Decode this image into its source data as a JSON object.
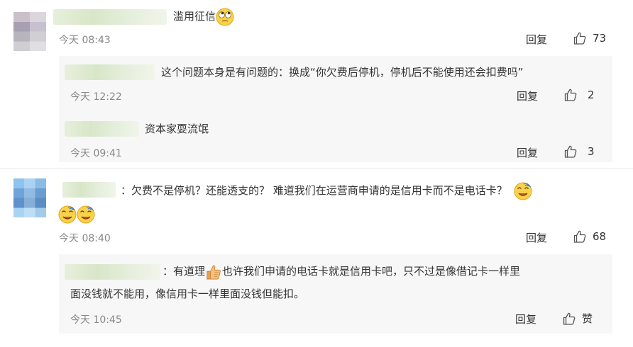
{
  "comments": [
    {
      "text": "滥用征信",
      "time": "今天 08:43",
      "reply_label": "回复",
      "likes": "73",
      "icon": "eye-roll-emoji",
      "replies": [
        {
          "text": "这个问题本身是有问题的：换成“你欠费后停机，停机后不能使用还会扣费吗”",
          "time": "今天 12:22",
          "reply_label": "回复",
          "likes": "2"
        },
        {
          "text": "资本家耍流氓",
          "time": "今天 09:41",
          "reply_label": "回复",
          "likes": "3"
        }
      ]
    },
    {
      "text_line1": "：欠费不是停机？还能透支的？ 难道我们在运营商申请的是信用卡而不是电话卡？",
      "time": "今天 08:40",
      "reply_label": "回复",
      "likes": "68",
      "icon": "dizzy-emoji",
      "replies": [
        {
          "prefix": "：有道理",
          "text_line1": "也许我们申请的电话卡就是信用卡吧，只不过是像借记卡一样里",
          "text_line2": "面没钱就不能用，像信用卡一样里面没钱但能扣。",
          "time": "今天 10:45",
          "reply_label": "回复",
          "likes": "赞",
          "icon": "thumbs-up-emoji"
        }
      ]
    }
  ]
}
